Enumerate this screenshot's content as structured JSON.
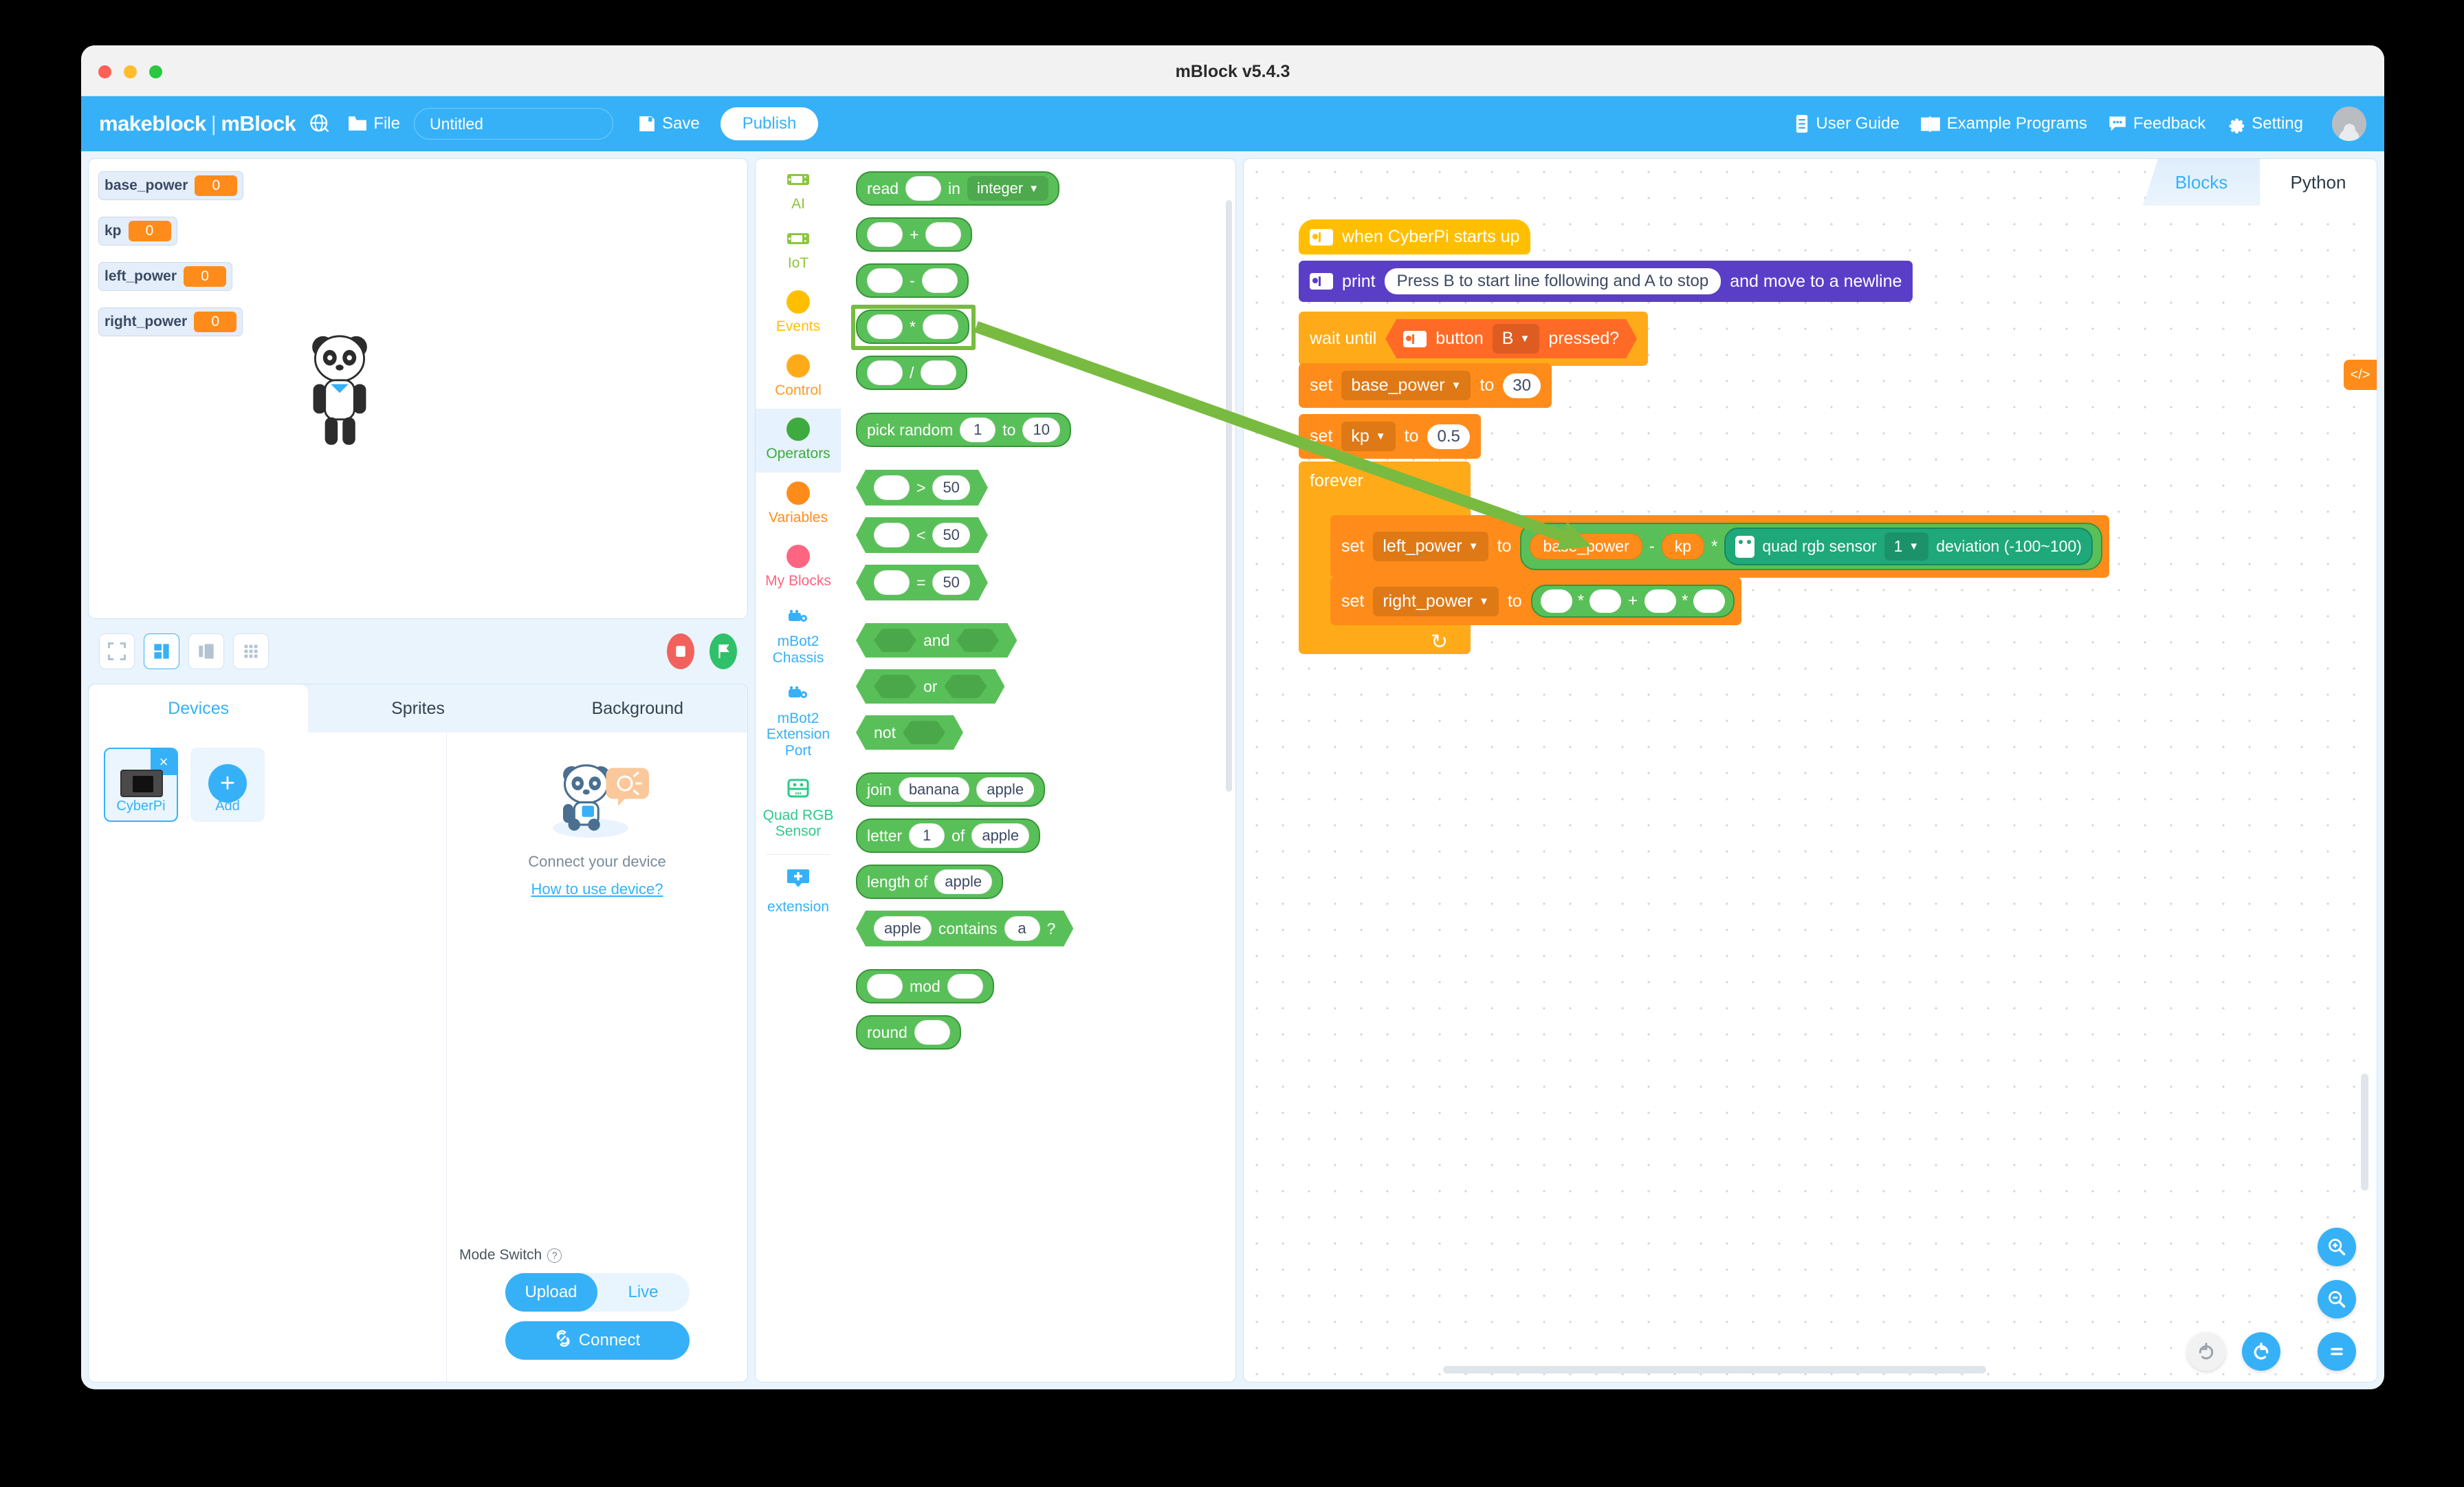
{
  "window": {
    "title": "mBlock v5.4.3"
  },
  "menubar": {
    "logo_left": "makeblock",
    "logo_divider": "|",
    "logo_right": "mBlock",
    "globe_icon": "globe-icon",
    "file_label": "File",
    "file_icon": "folder-icon",
    "project_name": "Untitled",
    "project_placeholder": "Untitled",
    "save_label": "Save",
    "save_icon": "floppy-disk-icon",
    "publish_label": "Publish",
    "right_items": [
      {
        "label": "User Guide",
        "icon": "book-icon"
      },
      {
        "label": "Example Programs",
        "icon": "open-book-icon"
      },
      {
        "label": "Feedback",
        "icon": "chat-bubble-icon"
      },
      {
        "label": "Setting",
        "icon": "gear-icon"
      }
    ],
    "avatar_icon": "user-avatar-icon"
  },
  "stage": {
    "variables": [
      {
        "name": "base_power",
        "value": "0"
      },
      {
        "name": "kp",
        "value": "0"
      },
      {
        "name": "left_power",
        "value": "0"
      },
      {
        "name": "right_power",
        "value": "0"
      }
    ],
    "sprite_icon": "panda-sprite",
    "toolbar_buttons": [
      {
        "icon": "fullscreen-icon",
        "selected": false
      },
      {
        "icon": "normal-layout-icon",
        "selected": true
      },
      {
        "icon": "small-stage-icon",
        "selected": false
      },
      {
        "icon": "grid-layout-icon",
        "selected": false
      }
    ],
    "stop_icon": "stop-button-icon",
    "go_icon": "green-flag-icon"
  },
  "devices": {
    "tabs": [
      {
        "label": "Devices",
        "active": true
      },
      {
        "label": "Sprites",
        "active": false
      },
      {
        "label": "Background",
        "active": false
      }
    ],
    "device_card": {
      "label": "CyberPi",
      "close_icon": "close-icon",
      "thumb_icon": "cyberpi-board-icon"
    },
    "add_card": {
      "label": "Add",
      "icon": "plus-icon"
    },
    "illustration_icon": "panda-robot-illustration",
    "connect_text": "Connect your device",
    "howto_link": "How to use device?",
    "mode_switch_label": "Mode Switch",
    "mode_help_icon": "question-mark-icon",
    "mode_options": [
      {
        "label": "Upload",
        "active": true
      },
      {
        "label": "Live",
        "active": false
      }
    ],
    "connect_button": "Connect",
    "connect_icon": "link-icon"
  },
  "palette": {
    "categories": [
      {
        "label": "AI",
        "icon": "cyberpi-icon",
        "color": "#8cc63f",
        "active": false,
        "type": "device"
      },
      {
        "label": "IoT",
        "icon": "cyberpi-icon",
        "color": "#8cc63f",
        "active": false,
        "type": "device"
      },
      {
        "label": "Events",
        "icon": "category-dot",
        "color": "#ffbf00",
        "active": false,
        "type": "dot"
      },
      {
        "label": "Control",
        "icon": "category-dot",
        "color": "#ffab19",
        "active": false,
        "type": "dot"
      },
      {
        "label": "Operators",
        "icon": "category-dot",
        "color": "#3eab3e",
        "active": true,
        "type": "dot"
      },
      {
        "label": "Variables",
        "icon": "category-dot",
        "color": "#ff8c1a",
        "active": false,
        "type": "dot"
      },
      {
        "label": "My Blocks",
        "icon": "category-dot",
        "color": "#fc6680",
        "active": false,
        "type": "dot"
      },
      {
        "label": "mBot2 Chassis",
        "icon": "mbot2-icon",
        "color": "#36b1f7",
        "active": false,
        "type": "device"
      },
      {
        "label": "mBot2 Extension Port",
        "icon": "mbot2-icon",
        "color": "#36b1f7",
        "active": false,
        "type": "device"
      },
      {
        "label": "Quad RGB Sensor",
        "icon": "quad-rgb-sensor-icon",
        "color": "#2ec98a",
        "active": false,
        "type": "device"
      },
      {
        "label": "extension",
        "icon": "plus-badge-icon",
        "color": "#36b1f7",
        "active": false,
        "type": "ext"
      }
    ],
    "blocks": {
      "read_label": "read",
      "read_in": "in",
      "read_type": "integer",
      "op_add": "+",
      "op_sub": "-",
      "op_mul": "*",
      "op_div": "/",
      "pick_random": "pick random",
      "pick_random_from": "1",
      "pick_random_to_label": "to",
      "pick_random_to": "10",
      "gt": ">",
      "gt_val": "50",
      "lt": "<",
      "lt_val": "50",
      "eq": "=",
      "eq_val": "50",
      "and": "and",
      "or": "or",
      "not": "not",
      "join": "join",
      "join_a": "banana",
      "join_b": "apple",
      "letter": "letter",
      "letter_n": "1",
      "letter_of": "of",
      "letter_str": "apple",
      "length_of": "length of",
      "length_str": "apple",
      "contains_str": "apple",
      "contains_label": "contains",
      "contains_val": "a",
      "contains_q": "?",
      "mod": "mod",
      "round": "round"
    },
    "highlighted_block": "op_mul"
  },
  "code_area": {
    "tabs": [
      {
        "label": "Blocks",
        "active": true
      },
      {
        "label": "Python",
        "active": false
      }
    ],
    "code_tag_icon": "code-brackets-icon",
    "script": {
      "hat": {
        "icon": "cyberpi-icon",
        "label": "when CyberPi starts up"
      },
      "print": {
        "icon": "cyberpi-icon",
        "label_before": "print",
        "value": "Press B to start line following and A to stop",
        "label_after": "and move to a newline"
      },
      "wait_until": {
        "label": "wait until",
        "icon": "cyberpi-icon",
        "cond_before": "button",
        "cond_dropdown": "B",
        "cond_after": "pressed?"
      },
      "set_base_power": {
        "label": "set",
        "variable": "base_power",
        "to": "to",
        "value": "30"
      },
      "set_kp": {
        "label": "set",
        "variable": "kp",
        "to": "to",
        "value": "0.5"
      },
      "forever": {
        "label": "forever",
        "loop_icon": "loop-arrow-icon"
      },
      "set_left_power": {
        "label": "set",
        "variable": "left_power",
        "to": "to",
        "expr_a": "base_power",
        "op_outer": "-",
        "expr_b": "kp",
        "op_inner": "*",
        "sensor": {
          "icon": "quad-rgb-sensor-icon",
          "label_before": "quad rgb sensor",
          "index": "1",
          "label_after": "deviation (-100~100)"
        }
      },
      "set_right_power": {
        "label": "set",
        "variable": "right_power",
        "to": "to",
        "op_mul_1": "*",
        "op_plus": "+",
        "op_mul_2": "*"
      }
    },
    "fabs": [
      {
        "icon": "zoom-in-icon",
        "enabled": true
      },
      {
        "icon": "zoom-out-icon",
        "enabled": true
      },
      {
        "icon": "zoom-reset-icon",
        "enabled": true
      },
      {
        "icon": "undo-icon",
        "enabled": true
      },
      {
        "icon": "redo-icon",
        "enabled": false
      }
    ]
  },
  "annotation": {
    "type": "arrow",
    "color": "#78bb40",
    "from": "palette multiply block",
    "to": "set left_power expression"
  }
}
